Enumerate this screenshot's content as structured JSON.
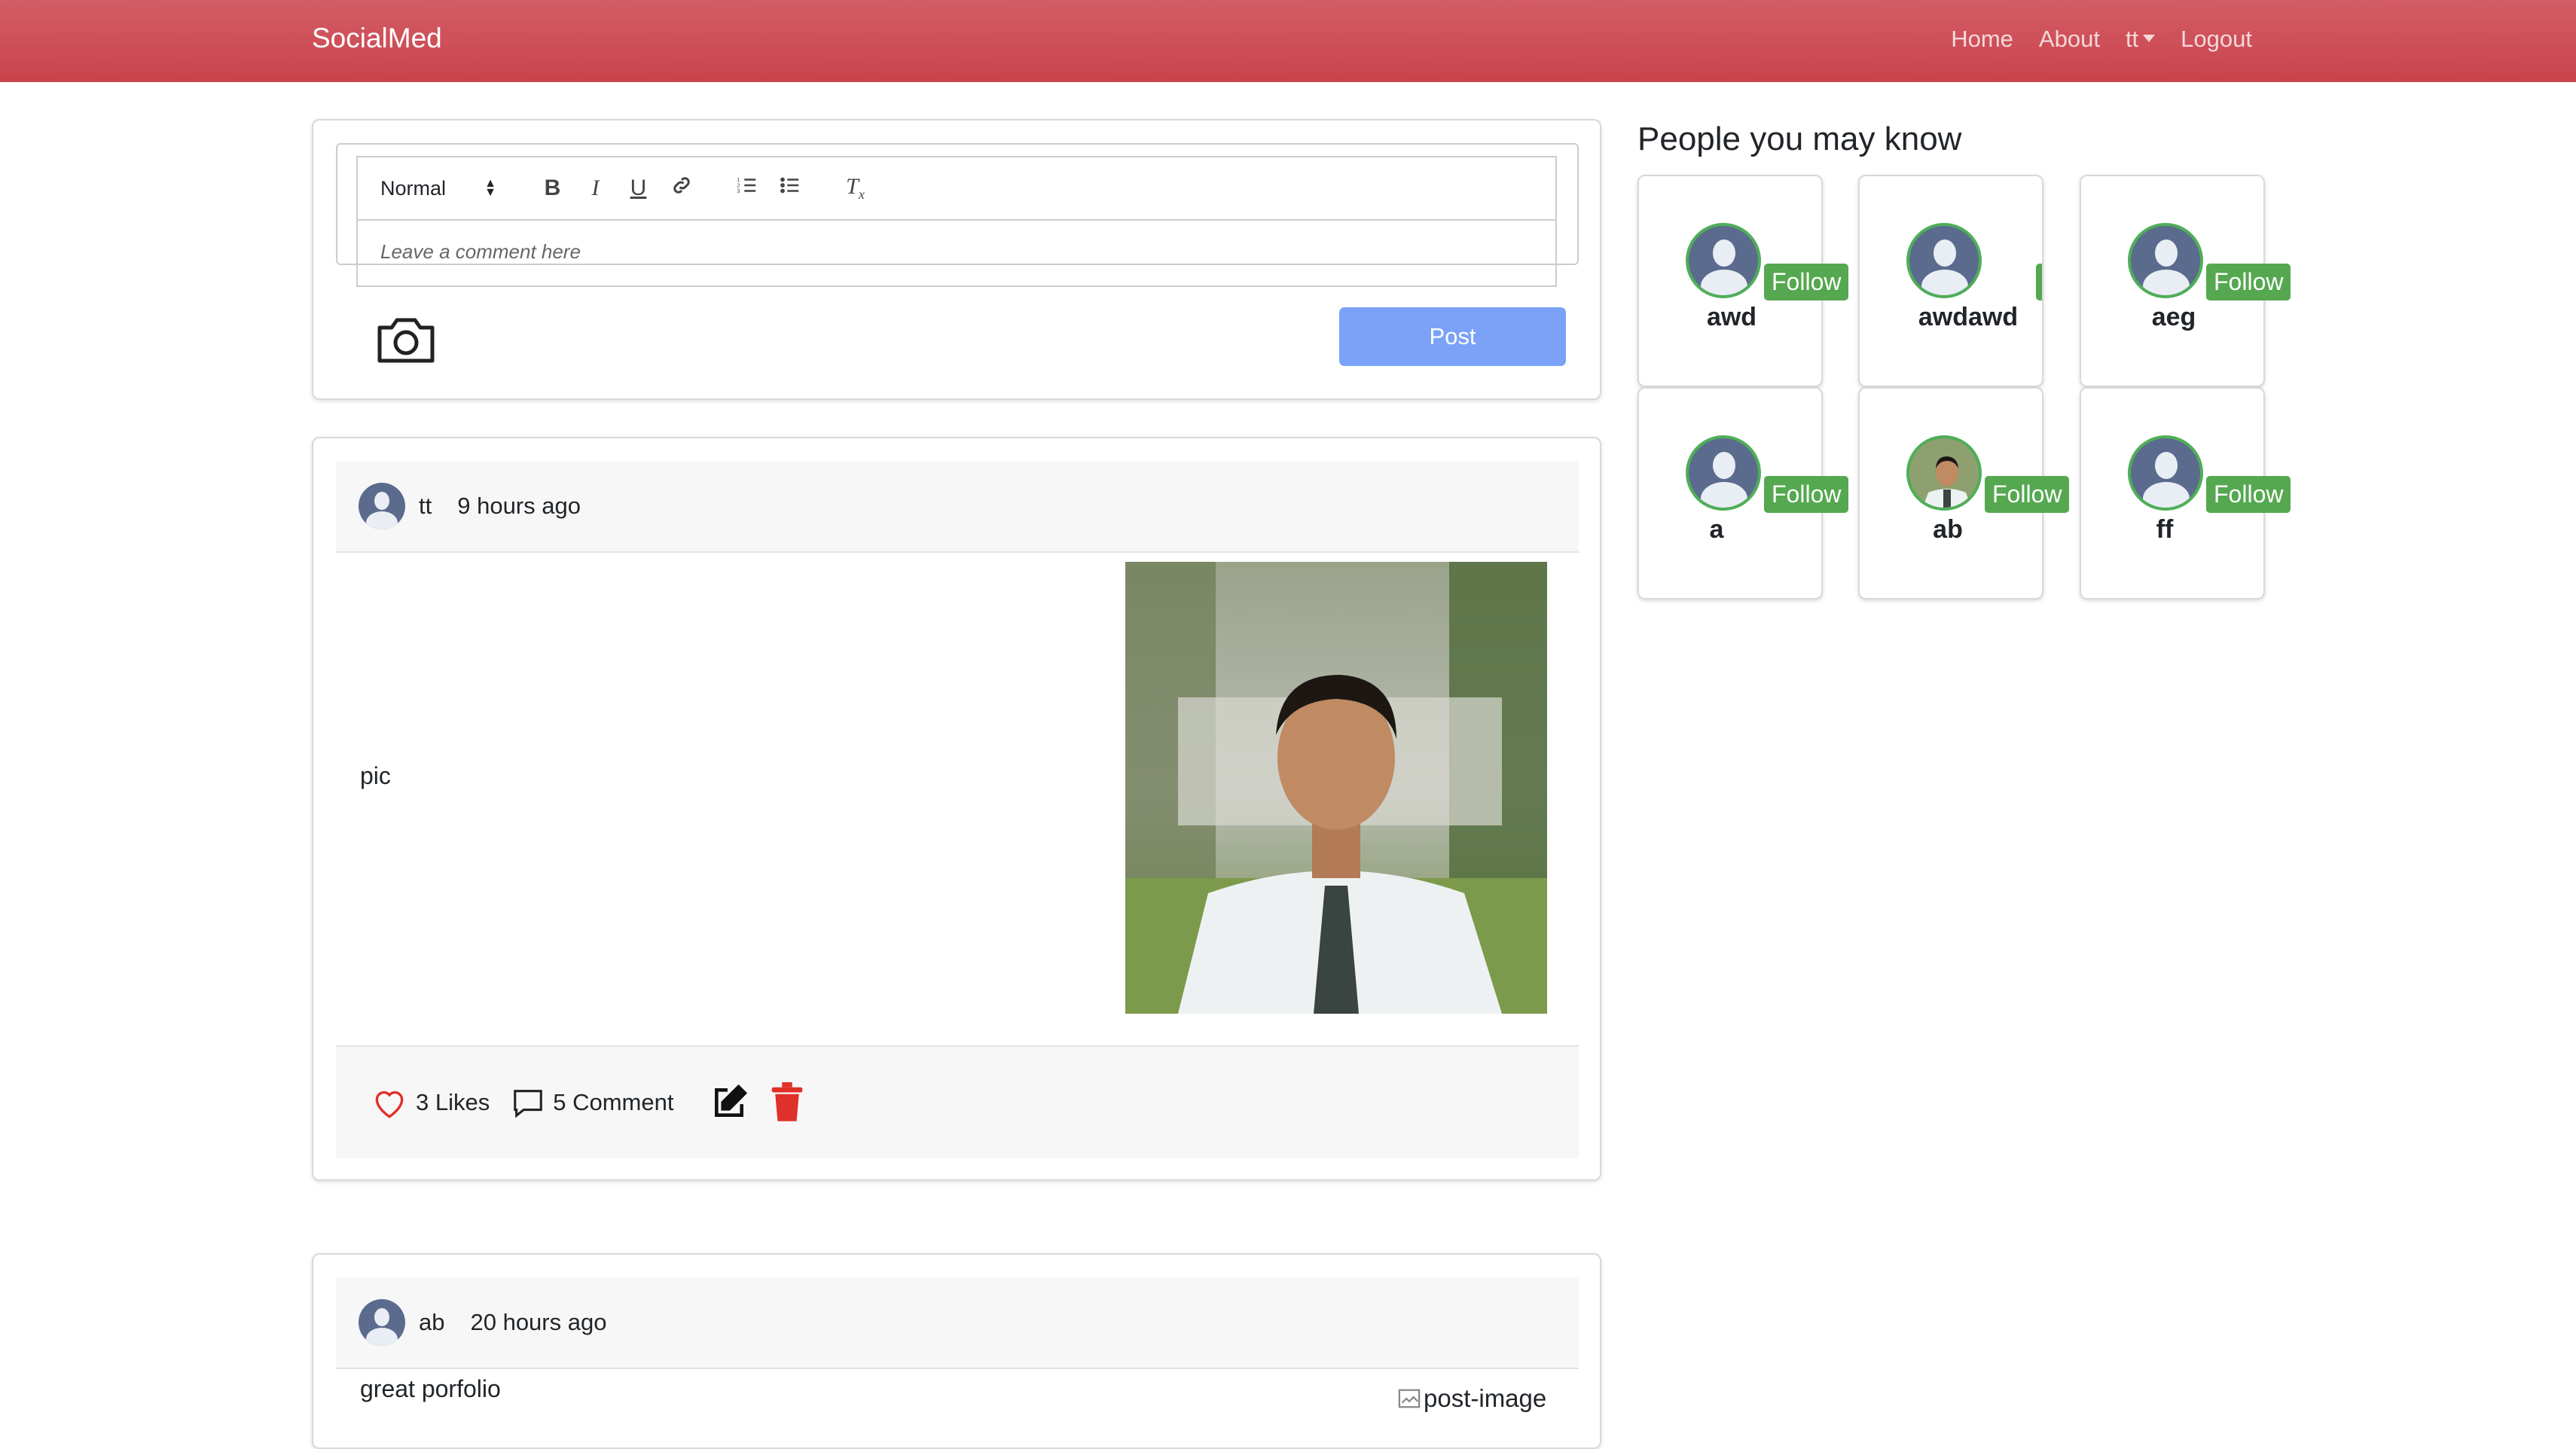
{
  "nav": {
    "brand": "SocialMed",
    "links": [
      "Home",
      "About",
      "tt",
      "Logout"
    ]
  },
  "composer": {
    "format_select": "Normal",
    "toolbar": {
      "bold": "B",
      "italic": "I",
      "underline": "U",
      "clean": "Tx"
    },
    "placeholder": "Leave a comment here",
    "post_button": "Post"
  },
  "posts": [
    {
      "author": "tt",
      "time": "9 hours ago",
      "text": "pic",
      "likes": "3 Likes",
      "comments": "5 Comment"
    },
    {
      "author": "ab",
      "time": "20 hours ago",
      "text": "great porfolio",
      "image_alt": "post-image"
    }
  ],
  "sidebar": {
    "title": "People you may know",
    "follow_label": "Follow",
    "people": [
      "awd",
      "awdawd",
      "aeg",
      "a",
      "ab",
      "ff"
    ]
  },
  "colors": {
    "navbar": "#c8434c",
    "follow": "#55a84f",
    "post_button": "#7ba2f7",
    "like": "#e0302a",
    "delete": "#e0302a"
  }
}
